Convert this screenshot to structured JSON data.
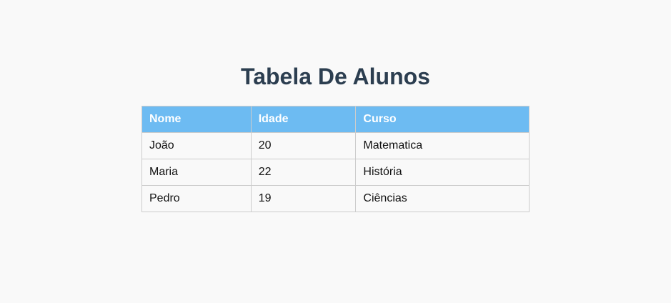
{
  "page": {
    "title": "Tabela De Alunos"
  },
  "table": {
    "headers": [
      "Nome",
      "Idade",
      "Curso"
    ],
    "rows": [
      [
        "João",
        "20",
        "Matematica"
      ],
      [
        "Maria",
        "22",
        "História"
      ],
      [
        "Pedro",
        "19",
        "Ciências"
      ]
    ]
  },
  "colors": {
    "background": "#f9f9f9",
    "title": "#2c3e50",
    "header_bg": "#6dbbf2",
    "header_text": "#ffffff",
    "border": "#cccccc"
  }
}
